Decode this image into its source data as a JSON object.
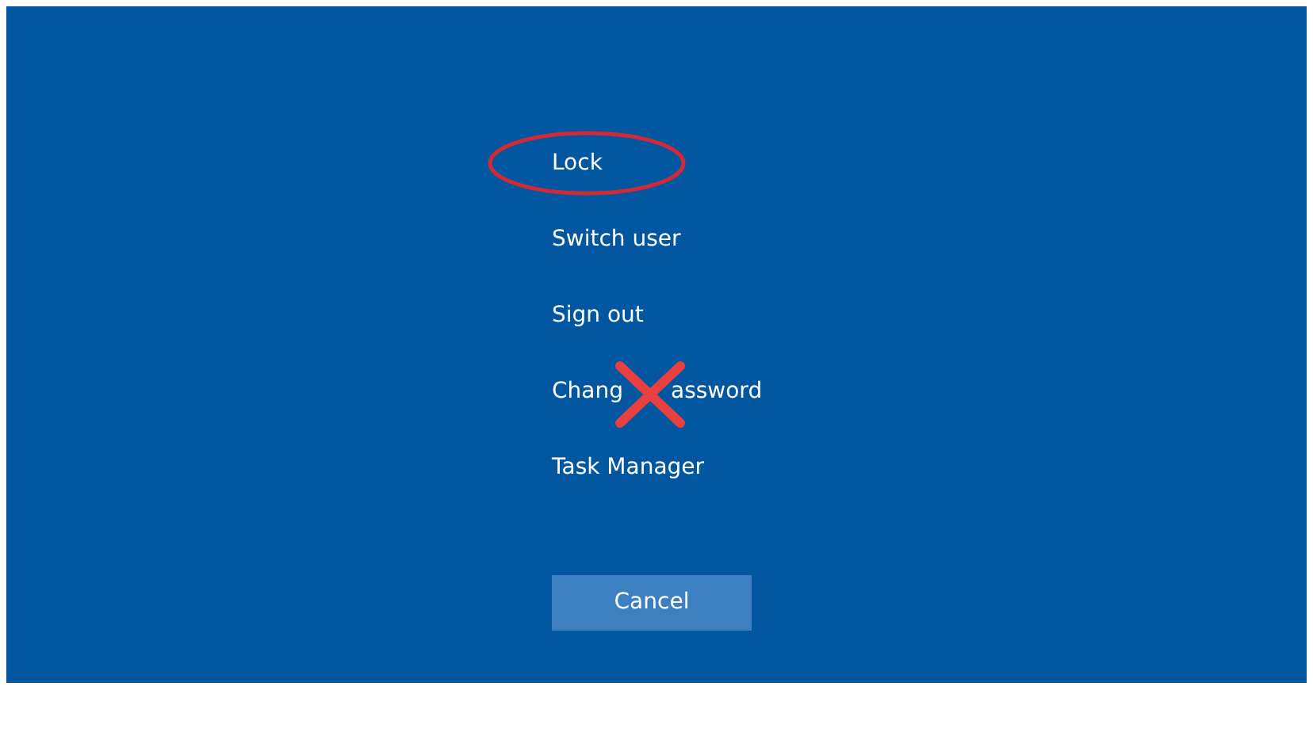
{
  "options": [
    {
      "label": "Lock",
      "circled": true,
      "crossed_out": false
    },
    {
      "label": "Switch user",
      "circled": false,
      "crossed_out": false
    },
    {
      "label": "Sign out",
      "circled": false,
      "crossed_out": false
    },
    {
      "label": "Chang",
      "label_after_mark": "assword",
      "circled": false,
      "crossed_out": true
    },
    {
      "label": "Task Manager",
      "circled": false,
      "crossed_out": false
    }
  ],
  "cancel_button": "Cancel"
}
